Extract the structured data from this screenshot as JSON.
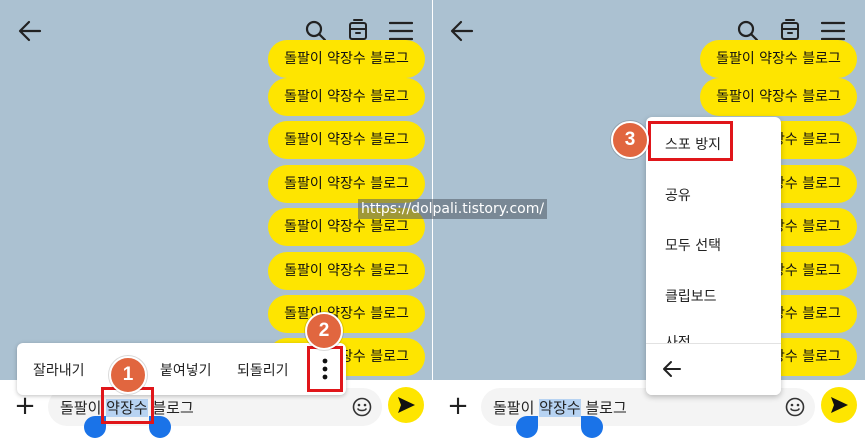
{
  "bubble_text": "돌팔이 약장수 블로그",
  "left": {
    "input": {
      "before": "돌팔이 ",
      "selected": "약장수",
      "after": " 블로그"
    },
    "context_menu": {
      "cut": "잘라내기",
      "paste": "붙여넣기",
      "undo": "되돌리기"
    },
    "badges": [
      "1",
      "2"
    ]
  },
  "right": {
    "input": {
      "before": "돌팔이 ",
      "selected": "약장수",
      "after": " 블로그"
    },
    "overflow_menu": {
      "items": [
        "스포 방지",
        "공유",
        "모두 선택",
        "클립보드",
        "사전"
      ]
    },
    "badge": "3"
  },
  "watermark": "https://dolpali.tistory.com/",
  "icons": [
    "back-arrow-icon",
    "search-icon",
    "calendar-icon",
    "hamburger-menu-icon",
    "plus-icon",
    "emoji-icon",
    "send-icon",
    "more-vertical-icon"
  ],
  "colors": {
    "chat_background": "#abc1d1",
    "bubble": "#fee500",
    "highlight": "#e0161a",
    "badge": "#e1663f",
    "selection_handle": "#1a73e8"
  }
}
